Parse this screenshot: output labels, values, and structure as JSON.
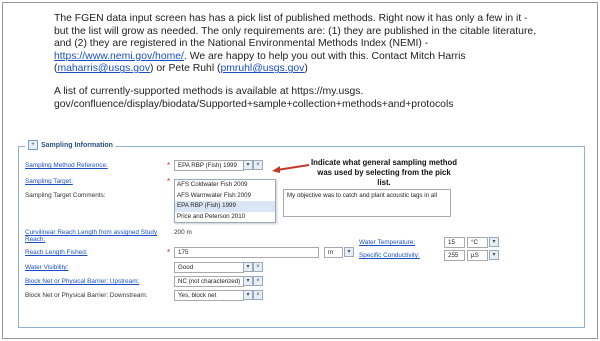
{
  "intro": {
    "p1_text1": "The FGEN data input screen has has a pick list of published methods. Right now it has only a few in it - but the list will grow as needed. The only requirements are: (1) they are published in the citable literature, and (2) they are registered in the National Environmental Methods Index (NEMI) - ",
    "p1_link_nemi": "https://www.nemi.gov/home/",
    "p1_text2": ". We are happy to help you out with this. Contact Mitch Harris (",
    "p1_link_email1": "maharris@usgs.gov",
    "p1_text3": ") or Pete Ruhl (",
    "p1_link_email2": "pmruhl@usgs.gov",
    "p1_text4": ")",
    "p2_text": "A list of currently-supported methods is available at https://my.usgs. gov/confluence/display/biodata/Supported+sample+collection+methods+and+protocols"
  },
  "section": {
    "title": "Sampling Information",
    "toggle": "+"
  },
  "labels": {
    "method_ref": "Sampling Method Reference:",
    "target": "Sampling Target:",
    "target_comments": "Sampling Target Comments:",
    "reach_length": "Curvilinear Reach Length from assigned Study",
    "reach_length2": "Reach:",
    "reach_fished": "Reach Length Fished:",
    "visibility": "Water Visibility:",
    "barrier_up": "Block Net or Physical Barrier: Upstream:",
    "barrier_down": "Block Net or Physical Barrier: Downstream:",
    "water_temp": "Water Temperature:",
    "conductivity": "Specific Conductivity:"
  },
  "values": {
    "method_ref": "EPA RBP (Fish) 1999",
    "target_comments": "My objective was to catch and plant acoustic tags in all",
    "reach_length": "200 m",
    "reach_fished": "175",
    "reach_fished_unit": "m",
    "visibility": "Good",
    "barrier_up": "NC (not characterized)",
    "barrier_down": "Yes, block net",
    "water_temp": "15",
    "water_temp_unit": "°C",
    "conductivity": "255",
    "conductivity_unit": "µS"
  },
  "dropdown_options": [
    "AFS Coldwater Fish 2009",
    "AFS Warmwater Fish 2009",
    "EPA RBP (Fish) 1999",
    "Price and Peterson 2010"
  ],
  "dropdown_selected_index": 2,
  "callout": "Indicate what general sampling method was used by selecting from the pick list.",
  "glyphs": {
    "required": "*",
    "chevron": "▾",
    "clear": "×"
  },
  "colors": {
    "link": "#1a4fc4",
    "arrow": "#c0392b",
    "panel_border": "#8fb0d0"
  }
}
